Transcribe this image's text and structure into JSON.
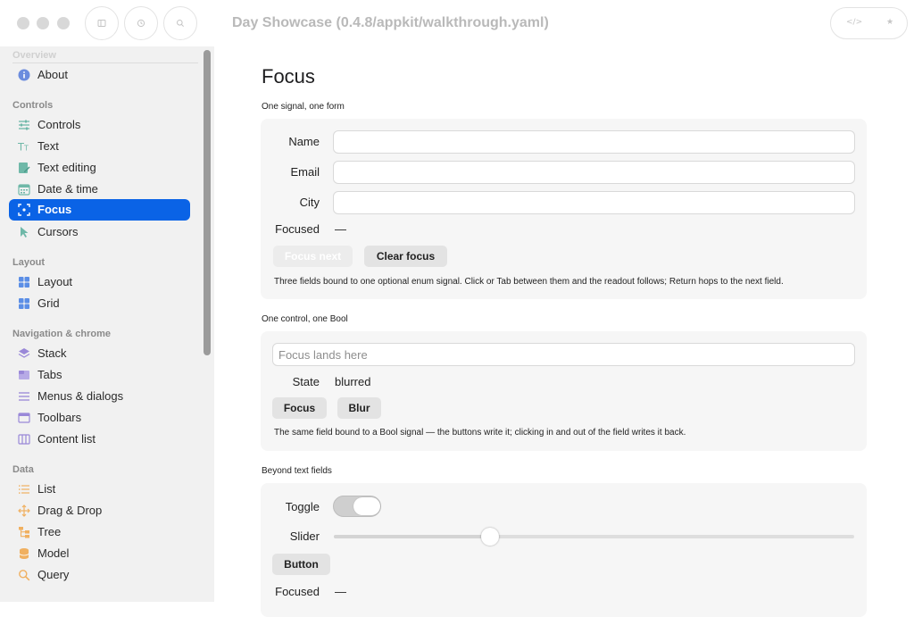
{
  "window": {
    "title": "Day Showcase (0.4.8/appkit/walkthrough.yaml)"
  },
  "toolbar": {
    "sidebar_icon": "sidebar-icon",
    "back_icon": "history-icon",
    "search_icon": "search-icon",
    "code_glyph": "</>",
    "star_glyph": "★"
  },
  "sidebar": {
    "sections": [
      {
        "title": "Overview",
        "items": [
          {
            "label": "About",
            "icon": "info-icon",
            "color": "#6b8cde"
          }
        ]
      },
      {
        "title": "Controls",
        "items": [
          {
            "label": "Controls",
            "icon": "sliders-icon",
            "color": "#6fb8a8"
          },
          {
            "label": "Text",
            "icon": "text-size-icon",
            "color": "#6fb8a8"
          },
          {
            "label": "Text editing",
            "icon": "edit-icon",
            "color": "#6fb8a8"
          },
          {
            "label": "Date & time",
            "icon": "calendar-icon",
            "color": "#6fb8a8"
          },
          {
            "label": "Focus",
            "icon": "focus-icon",
            "color": "#ffffff",
            "selected": true
          },
          {
            "label": "Cursors",
            "icon": "cursor-icon",
            "color": "#6fb8a8"
          }
        ]
      },
      {
        "title": "Layout",
        "items": [
          {
            "label": "Layout",
            "icon": "layout-grid-icon",
            "color": "#5b8ee6"
          },
          {
            "label": "Grid",
            "icon": "grid-icon",
            "color": "#5b8ee6"
          }
        ]
      },
      {
        "title": "Navigation & chrome",
        "items": [
          {
            "label": "Stack",
            "icon": "stack-icon",
            "color": "#9a88d8"
          },
          {
            "label": "Tabs",
            "icon": "tabs-icon",
            "color": "#9a88d8"
          },
          {
            "label": "Menus & dialogs",
            "icon": "menu-icon",
            "color": "#9a88d8"
          },
          {
            "label": "Toolbars",
            "icon": "toolbar-icon",
            "color": "#9a88d8"
          },
          {
            "label": "Content list",
            "icon": "columns-icon",
            "color": "#9a88d8"
          }
        ]
      },
      {
        "title": "Data",
        "items": [
          {
            "label": "List",
            "icon": "list-icon",
            "color": "#f0b060"
          },
          {
            "label": "Drag & Drop",
            "icon": "move-icon",
            "color": "#f0b060"
          },
          {
            "label": "Tree",
            "icon": "tree-icon",
            "color": "#f0b060"
          },
          {
            "label": "Model",
            "icon": "database-icon",
            "color": "#f0b060"
          },
          {
            "label": "Query",
            "icon": "search-icon",
            "color": "#f0b060"
          }
        ]
      }
    ]
  },
  "page": {
    "title": "Focus",
    "section1": {
      "label": "One signal, one form",
      "name_label": "Name",
      "name_value": "",
      "email_label": "Email",
      "email_value": "",
      "city_label": "City",
      "city_value": "",
      "focused_label": "Focused",
      "focused_value": "—",
      "focus_next": "Focus next",
      "clear_focus": "Clear focus",
      "note": "Three fields bound to one optional enum signal. Click or Tab between them and the readout follows; Return hops to the next field."
    },
    "section2": {
      "label": "One control, one Bool",
      "placeholder": "Focus lands here",
      "state_label": "State",
      "state_value": "blurred",
      "focus_btn": "Focus",
      "blur_btn": "Blur",
      "note": "The same field bound to a Bool signal — the buttons write it; clicking in and out of the field writes it back."
    },
    "section3": {
      "label": "Beyond text fields",
      "toggle_label": "Toggle",
      "toggle_on": true,
      "slider_label": "Slider",
      "slider_value": 0.3,
      "button_label": "Button",
      "focused_label": "Focused",
      "focused_value": "—"
    }
  },
  "colors": {
    "accent": "#0a63e6",
    "sidebar_bg": "#f1f1f1",
    "card_bg": "#f6f6f6"
  }
}
